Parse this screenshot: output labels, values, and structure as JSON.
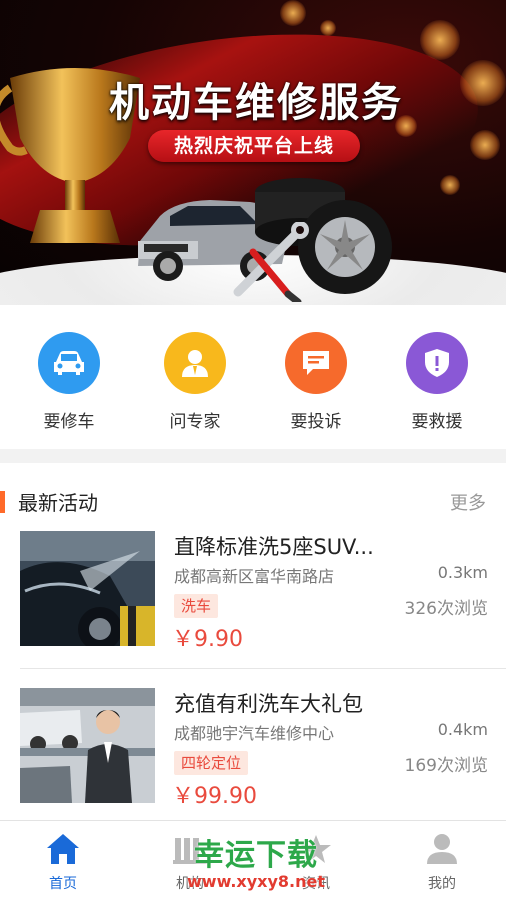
{
  "banner": {
    "title": "机动车维修服务",
    "subtitle": "热烈庆祝平台上线"
  },
  "quick_menu": [
    {
      "label": "要修车",
      "icon": "car-icon",
      "color": "#2f9bf0"
    },
    {
      "label": "问专家",
      "icon": "expert-icon",
      "color": "#f8b81c"
    },
    {
      "label": "要投诉",
      "icon": "complaint-icon",
      "color": "#f66a2c"
    },
    {
      "label": "要救援",
      "icon": "rescue-shield-icon",
      "color": "#8a58d6"
    }
  ],
  "activities": {
    "title": "最新活动",
    "more": "更多",
    "items": [
      {
        "title": "直降标准洗5座SUV...",
        "address": "成都高新区富华南路店",
        "distance": "0.3km",
        "tag": "洗车",
        "views": "326次浏览",
        "price": "￥9.90"
      },
      {
        "title": "充值有利洗车大礼包",
        "address": "成都驰宇汽车维修中心",
        "distance": "0.4km",
        "tag": "四轮定位",
        "views": "169次浏览",
        "price": "￥99.90"
      }
    ]
  },
  "tabbar": [
    {
      "label": "首页",
      "icon": "home-icon",
      "active": true
    },
    {
      "label": "机构",
      "icon": "institution-icon",
      "active": false
    },
    {
      "label": "资讯",
      "icon": "news-icon",
      "active": false
    },
    {
      "label": "我的",
      "icon": "profile-icon",
      "active": false
    }
  ],
  "watermark": {
    "main": "幸运下载",
    "url": "www.xyxy8.net"
  },
  "colors": {
    "accent": "#ff6a2a",
    "price": "#e94a3d",
    "tab_active": "#1a6ad8"
  }
}
